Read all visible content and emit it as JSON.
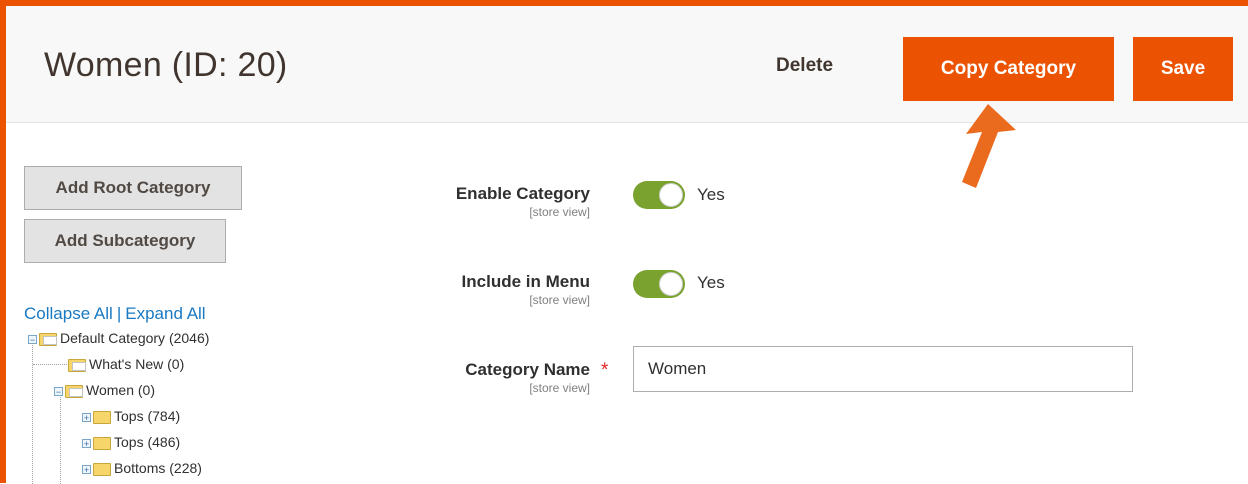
{
  "header": {
    "title": "Women (ID: 20)",
    "delete_label": "Delete",
    "copy_label": "Copy Category",
    "save_label": "Save"
  },
  "sidebar": {
    "add_root_label": "Add Root Category",
    "add_sub_label": "Add Subcategory",
    "collapse_all": "Collapse All",
    "separator": "|",
    "expand_all": "Expand All",
    "tree": [
      {
        "label": "Default Category (2046)"
      },
      {
        "label": "What's New (0)"
      },
      {
        "label": "Women (0)"
      },
      {
        "label": "Tops (784)"
      },
      {
        "label": "Tops (486)"
      },
      {
        "label": "Bottoms (228)"
      }
    ]
  },
  "form": {
    "enable_category": {
      "label": "Enable Category",
      "scope": "[store view]",
      "value": "Yes",
      "on": true
    },
    "include_in_menu": {
      "label": "Include in Menu",
      "scope": "[store view]",
      "value": "Yes",
      "on": true
    },
    "category_name": {
      "label": "Category Name",
      "scope": "[store view]",
      "required_mark": "*",
      "value": "Women"
    }
  },
  "colors": {
    "accent": "#eb5202",
    "toggle_on": "#79a22e",
    "link": "#1979c3"
  }
}
